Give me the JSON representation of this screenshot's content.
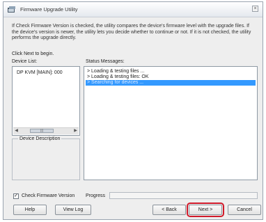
{
  "window": {
    "title": "Firmware Upgrade Utility",
    "close_glyph": "×"
  },
  "description": "If Check Firmware Version is checked, the utility compares the device's firmware level with the upgrade files. If the device's version is newer, the utility lets you decide whether to continue or not. If it is not checked, the utility performs the upgrade directly.",
  "instructions": "Click Next to begin.",
  "device_list": {
    "label": "Device List:",
    "items": [
      "DP KVM [MAIN]: 000"
    ]
  },
  "device_description": {
    "label": "Device Description"
  },
  "status": {
    "label": "Status Messages:",
    "messages": [
      "> Loading & testing files ...",
      "> Loading & testing files: OK",
      "> Searching for devices ..."
    ],
    "selected_index": 2
  },
  "check_firmware": {
    "label": "Check Firmware Version",
    "checked": true,
    "check_glyph": "✓"
  },
  "progress": {
    "label": "Progress",
    "value": 0
  },
  "buttons": {
    "help": "Help",
    "view_log": "View Log",
    "back": "< Back",
    "next": "Next >",
    "cancel": "Cancel"
  },
  "colors": {
    "selection": "#3399ff",
    "highlight_outline": "#d11a2a"
  }
}
